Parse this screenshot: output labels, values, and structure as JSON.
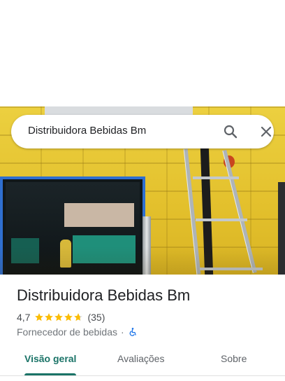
{
  "search": {
    "query": "Distribuidora Bebidas Bm"
  },
  "place": {
    "name": "Distribuidora Bebidas Bm",
    "rating": "4,7",
    "stars_filled": 4.7,
    "stars_max": 5,
    "review_count": "(35)",
    "category": "Fornecedor de bebidas",
    "separator": "·",
    "accessibility_icon": "wheelchair-icon"
  },
  "tabs": [
    {
      "label": "Visão geral",
      "active": true
    },
    {
      "label": "Avaliações",
      "active": false
    },
    {
      "label": "Sobre",
      "active": false
    }
  ],
  "colors": {
    "accent": "#1a7367",
    "star": "#fbbc04",
    "accessibility": "#1a73e8"
  },
  "icons": {
    "search": "search-icon",
    "close": "close-icon"
  }
}
